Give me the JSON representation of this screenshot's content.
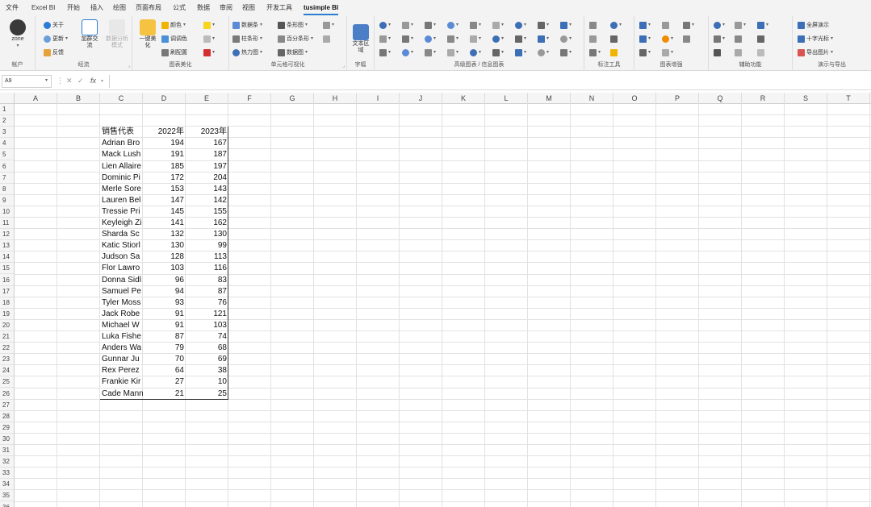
{
  "menu": {
    "tabs": [
      {
        "label": "文件",
        "active": false
      },
      {
        "label": "Excel BI",
        "active": false
      },
      {
        "label": "开始",
        "active": false
      },
      {
        "label": "插入",
        "active": false
      },
      {
        "label": "绘图",
        "active": false
      },
      {
        "label": "页面布局",
        "active": false
      },
      {
        "label": "公式",
        "active": false
      },
      {
        "label": "数据",
        "active": false
      },
      {
        "label": "审阅",
        "active": false
      },
      {
        "label": "视图",
        "active": false
      },
      {
        "label": "开发工具",
        "active": false
      },
      {
        "label": "tusimple BI",
        "active": true
      }
    ]
  },
  "ribbon": {
    "group_labels": [
      "帐户",
      "经流",
      "图表美化",
      "单元格可视化",
      "字幅",
      "高级图表 / 信息图表",
      "标注工具",
      "图表增强",
      "辅助功能",
      "演示与导出"
    ],
    "account": {
      "label": "zone"
    },
    "flow": {
      "items": [
        "关于",
        "更新",
        "反馈"
      ],
      "big_labels": [
        "加群交流",
        "数据分析模式"
      ]
    },
    "chart_beautify": {
      "big_label": "一键美化",
      "items": [
        "颜色",
        "调调色",
        "刷配置"
      ]
    },
    "cell_viz": {
      "items": [
        "数据条",
        "柱条形",
        "热力图",
        "条形图",
        "百分条形",
        "数据图"
      ]
    },
    "banner": {
      "label": "文本区域"
    },
    "demo_export": {
      "items": [
        "全屏演示",
        "十字光标",
        "导出图片"
      ]
    }
  },
  "formula_bar": {
    "name_box": "A9",
    "formula": ""
  },
  "grid": {
    "columns": [
      "A",
      "B",
      "C",
      "D",
      "E",
      "F",
      "G",
      "H",
      "I",
      "J",
      "K",
      "L",
      "M",
      "N",
      "O",
      "P",
      "Q",
      "R",
      "S",
      "T"
    ],
    "rows": [
      "1",
      "2",
      "3",
      "4",
      "5",
      "6",
      "7",
      "8",
      "9",
      "10",
      "11",
      "12",
      "13",
      "14",
      "15",
      "16",
      "17",
      "18",
      "19",
      "20",
      "21",
      "22",
      "23",
      "24",
      "25",
      "26",
      "27",
      "28",
      "29",
      "30",
      "31",
      "32",
      "33",
      "34",
      "35",
      "36"
    ]
  },
  "table": {
    "headers": [
      "销售代表",
      "2022年",
      "2023年"
    ],
    "rows": [
      [
        "Adrian Bro",
        "194",
        "167"
      ],
      [
        "Mack Lush",
        "191",
        "187"
      ],
      [
        "Lien Allaire",
        "185",
        "197"
      ],
      [
        "Dominic Pi",
        "172",
        "204"
      ],
      [
        "Merle Sore",
        "153",
        "143"
      ],
      [
        "Lauren Bel",
        "147",
        "142"
      ],
      [
        "Tressie Pri",
        "145",
        "155"
      ],
      [
        "Keyleigh Zi",
        "141",
        "162"
      ],
      [
        "Sharda Sc",
        "132",
        "130"
      ],
      [
        "Katic Stiorl",
        "130",
        "99"
      ],
      [
        "Judson Sa",
        "128",
        "113"
      ],
      [
        "Flor Lawro",
        "103",
        "116"
      ],
      [
        "Donna Sidl",
        "96",
        "83"
      ],
      [
        "Samuel Pe",
        "94",
        "87"
      ],
      [
        "Tyler Moss",
        "93",
        "76"
      ],
      [
        "Jack Robe",
        "91",
        "121"
      ],
      [
        "Michael W",
        "91",
        "103"
      ],
      [
        "Luka Fishe",
        "87",
        "74"
      ],
      [
        "Anders Wa",
        "79",
        "68"
      ],
      [
        "Gunnar Ju",
        "70",
        "69"
      ],
      [
        "Rex Perez",
        "64",
        "38"
      ],
      [
        "Frankie Kir",
        "27",
        "10"
      ],
      [
        "Cade Mann",
        "21",
        "25"
      ]
    ]
  }
}
